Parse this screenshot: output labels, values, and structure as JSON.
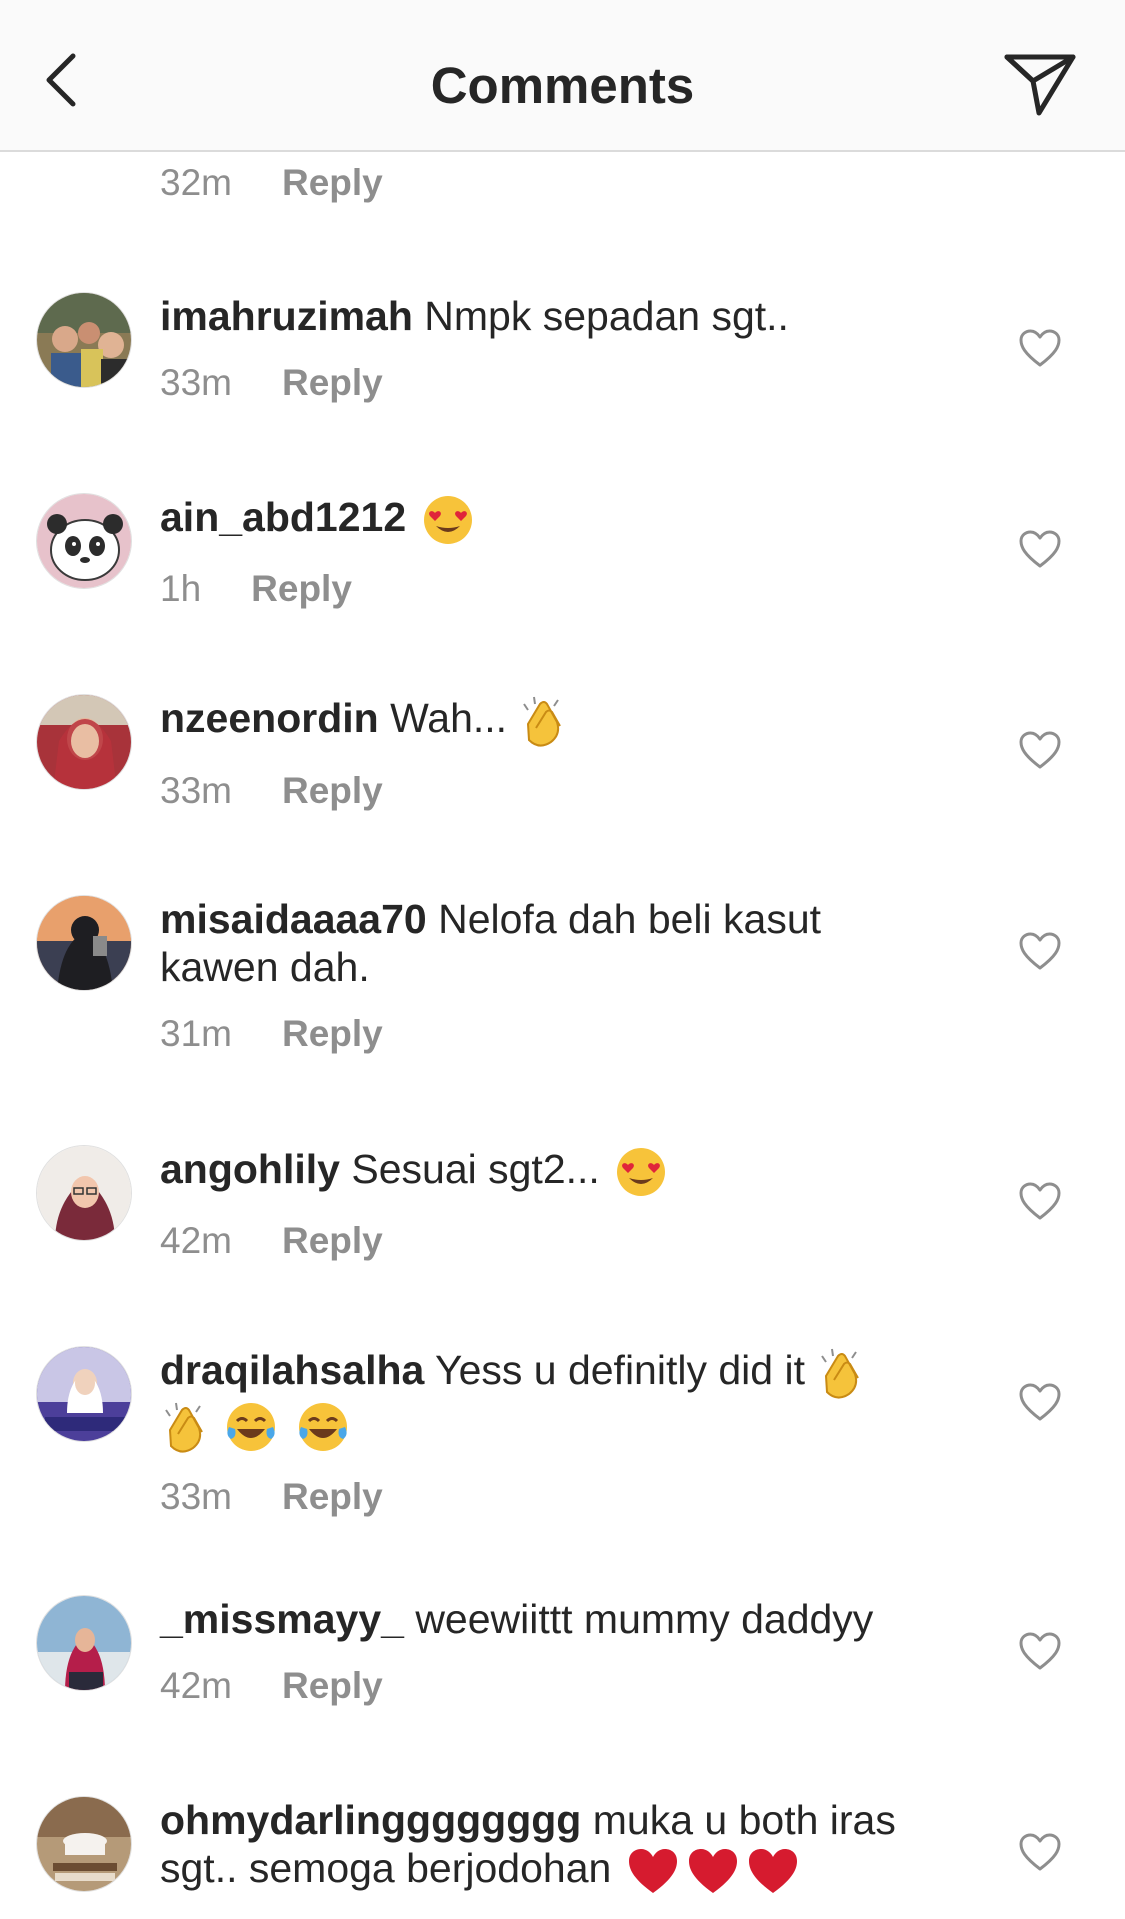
{
  "header": {
    "title": "Comments",
    "back_icon": "chevron-left-icon",
    "share_icon": "direct-send-icon"
  },
  "top_partial": {
    "time": "32m",
    "reply": "Reply"
  },
  "colors": {
    "text": "#262626",
    "secondary": "#8e8e8e",
    "header_bg": "#fafafa",
    "divider": "#dbdbdb",
    "heart_emoji": "#d61b2f",
    "face_emoji": "#f7c33a"
  },
  "comments": [
    {
      "username": "imahruzimah",
      "text": "Nmpk sepadan sgt..",
      "time": "33m",
      "reply": "Reply"
    },
    {
      "username": "ain_abd1212",
      "text": "",
      "emoji": "heart-eyes-face",
      "time": "1h",
      "reply": "Reply"
    },
    {
      "username": "nzeenordin",
      "text": "Wah...",
      "emoji": "clapping-hands",
      "time": "33m",
      "reply": "Reply"
    },
    {
      "username": "misaidaaaa70",
      "text": "Nelofa dah beli kasut",
      "text2": "kawen dah.",
      "time": "31m",
      "reply": "Reply"
    },
    {
      "username": "angohlily",
      "text": "Sesuai sgt2...",
      "emoji": "heart-eyes-face",
      "time": "42m",
      "reply": "Reply"
    },
    {
      "username": "draqilahsalha",
      "text": "Yess u definitly did it",
      "emoji": "clapping-hands, clapping-hands, tears-of-joy-face, tears-of-joy-face",
      "time": "33m",
      "reply": "Reply"
    },
    {
      "username": "_missmayy_",
      "text": "weewiittt mummy daddyy",
      "time": "42m",
      "reply": "Reply"
    },
    {
      "username": "ohmydarlingggggggg",
      "text": "muka u both iras",
      "text2": "sgt.. semoga berjodohan",
      "emoji": "red-heart, red-heart, red-heart"
    }
  ]
}
